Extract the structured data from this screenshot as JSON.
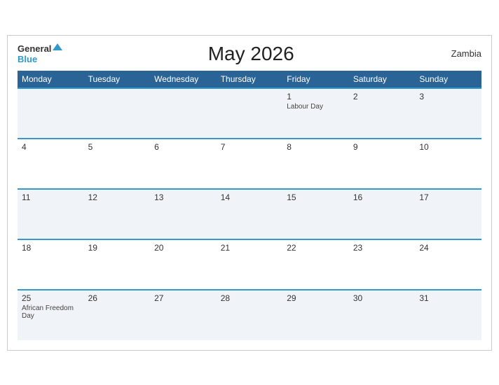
{
  "header": {
    "logo": {
      "general": "General",
      "blue": "Blue",
      "triangle": "▲"
    },
    "title": "May 2026",
    "country": "Zambia"
  },
  "weekdays": [
    "Monday",
    "Tuesday",
    "Wednesday",
    "Thursday",
    "Friday",
    "Saturday",
    "Sunday"
  ],
  "weeks": [
    [
      {
        "day": "",
        "event": ""
      },
      {
        "day": "",
        "event": ""
      },
      {
        "day": "",
        "event": ""
      },
      {
        "day": "",
        "event": ""
      },
      {
        "day": "1",
        "event": "Labour Day"
      },
      {
        "day": "2",
        "event": ""
      },
      {
        "day": "3",
        "event": ""
      }
    ],
    [
      {
        "day": "4",
        "event": ""
      },
      {
        "day": "5",
        "event": ""
      },
      {
        "day": "6",
        "event": ""
      },
      {
        "day": "7",
        "event": ""
      },
      {
        "day": "8",
        "event": ""
      },
      {
        "day": "9",
        "event": ""
      },
      {
        "day": "10",
        "event": ""
      }
    ],
    [
      {
        "day": "11",
        "event": ""
      },
      {
        "day": "12",
        "event": ""
      },
      {
        "day": "13",
        "event": ""
      },
      {
        "day": "14",
        "event": ""
      },
      {
        "day": "15",
        "event": ""
      },
      {
        "day": "16",
        "event": ""
      },
      {
        "day": "17",
        "event": ""
      }
    ],
    [
      {
        "day": "18",
        "event": ""
      },
      {
        "day": "19",
        "event": ""
      },
      {
        "day": "20",
        "event": ""
      },
      {
        "day": "21",
        "event": ""
      },
      {
        "day": "22",
        "event": ""
      },
      {
        "day": "23",
        "event": ""
      },
      {
        "day": "24",
        "event": ""
      }
    ],
    [
      {
        "day": "25",
        "event": "African Freedom Day"
      },
      {
        "day": "26",
        "event": ""
      },
      {
        "day": "27",
        "event": ""
      },
      {
        "day": "28",
        "event": ""
      },
      {
        "day": "29",
        "event": ""
      },
      {
        "day": "30",
        "event": ""
      },
      {
        "day": "31",
        "event": ""
      }
    ]
  ]
}
